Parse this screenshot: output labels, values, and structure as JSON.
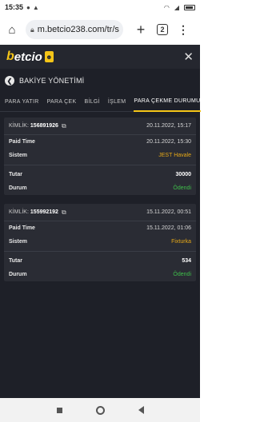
{
  "status_bar": {
    "time": "15:35"
  },
  "browser": {
    "url": "m.betcio238.com/tr/s",
    "tab_count": "2"
  },
  "app": {
    "logo_b": "b",
    "logo_text": "etcio",
    "page_title": "BAKİYE YÖNETİMİ",
    "tabs": [
      {
        "label": "PARA YATIR"
      },
      {
        "label": "PARA ÇEK"
      },
      {
        "label": "BİLGİ"
      },
      {
        "label": "İŞLEM"
      },
      {
        "label": "PARA ÇEKME DURUMU"
      }
    ],
    "withdrawals": [
      {
        "id_label": "KİMLİK:",
        "id": "156891926",
        "created": "20.11.2022, 15:17",
        "paid_time_label": "Paid Time",
        "paid_time": "20.11.2022, 15:30",
        "system_label": "Sistem",
        "system": "JEST Havale",
        "amount_label": "Tutar",
        "amount": "30000",
        "status_label": "Durum",
        "status": "Ödendi"
      },
      {
        "id_label": "KİMLİK:",
        "id": "155992192",
        "created": "15.11.2022, 00:51",
        "paid_time_label": "Paid Time",
        "paid_time": "15.11.2022, 01:06",
        "system_label": "Sistem",
        "system": "Fixturka",
        "amount_label": "Tutar",
        "amount": "534",
        "status_label": "Durum",
        "status": "Ödendi"
      }
    ]
  },
  "colors": {
    "accent": "#f5c518",
    "background": "#1e2028",
    "card": "#2a2c34",
    "system_text": "#e6a817",
    "status_paid": "#3fbf4a"
  }
}
